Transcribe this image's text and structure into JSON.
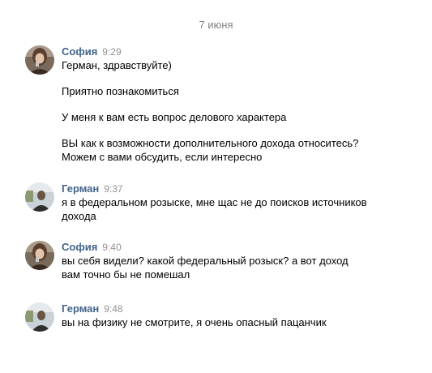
{
  "date_separator": "7 июня",
  "messages": [
    {
      "author": "София",
      "time": "9:29",
      "lines": [
        "Герман, здравствуйте)",
        "Приятно познакомиться",
        "У меня к вам есть вопрос делового характера",
        "ВЫ как к возможности дополнительного дохода относитесь?",
        "Можем с вами обсудить, если интересно"
      ]
    },
    {
      "author": "Герман",
      "time": "9:37",
      "lines": [
        "я в федеральном розыске, мне щас не до поисков источников",
        "дохода"
      ]
    },
    {
      "author": "София",
      "time": "9:40",
      "lines": [
        "вы себя видели? какой федеральный розыск? а вот доход",
        "вам точно бы не помешал"
      ]
    },
    {
      "author": "Герман",
      "time": "9:48",
      "lines": [
        "вы на физику не смотрите, я очень опасный пацанчик"
      ]
    }
  ],
  "colors": {
    "author": "#42648b",
    "time": "#939393",
    "date": "#828282",
    "text": "#000000"
  }
}
